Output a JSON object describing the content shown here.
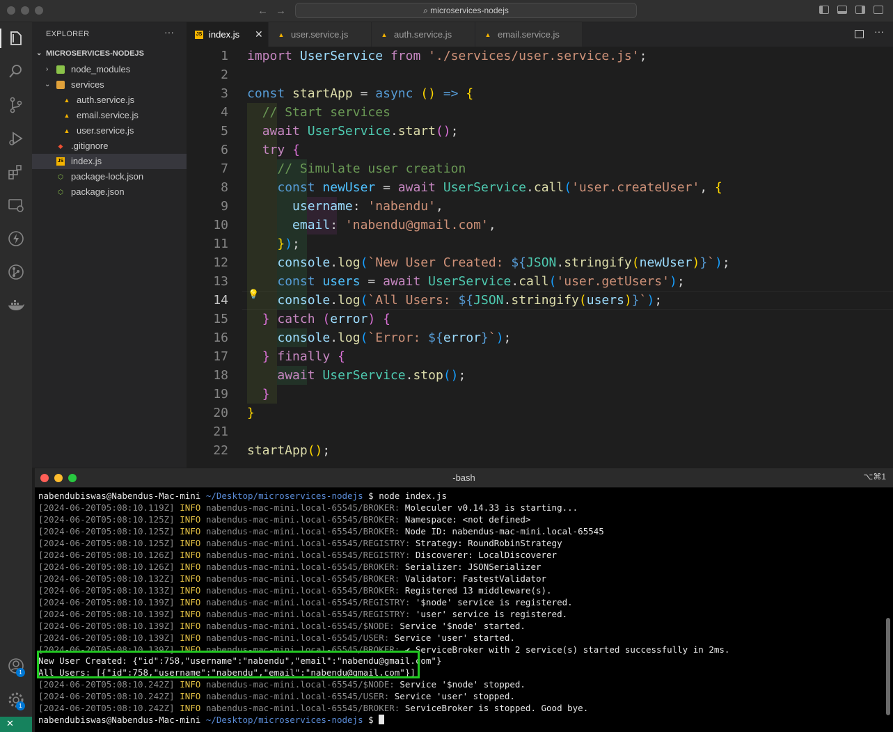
{
  "window": {
    "search": "microservices-nodejs"
  },
  "explorer": {
    "title": "EXPLORER",
    "more": "···",
    "project": "MICROSERVICES-NODEJS",
    "items": [
      "node_modules",
      "services",
      "auth.service.js",
      "email.service.js",
      "user.service.js",
      ".gitignore",
      "index.js",
      "package-lock.json",
      "package.json"
    ]
  },
  "activity": {
    "account_badge": "1",
    "settings_badge": "1"
  },
  "tabs": [
    {
      "label": "index.js",
      "close": "✕"
    },
    {
      "label": "user.service.js"
    },
    {
      "label": "auth.service.js"
    },
    {
      "label": "email.service.js"
    }
  ],
  "editor": {
    "line_numbers": [
      "1",
      "2",
      "3",
      "4",
      "5",
      "6",
      "7",
      "8",
      "9",
      "10",
      "11",
      "12",
      "13",
      "14",
      "15",
      "16",
      "17",
      "18",
      "19",
      "20",
      "21",
      "22"
    ],
    "current_line": "14"
  },
  "terminal": {
    "title": "-bash",
    "shortcut": "⌥⌘1",
    "prompt_user": "nabendubiswas@Nabendus-Mac-mini",
    "prompt_path": "~/Desktop/microservices-nodejs",
    "prompt_cmd": "$ node index.js",
    "prompt_end": "$",
    "logs": [
      {
        "ts": "[2024-06-20T05:08:10.119Z]",
        "lvl": "INFO",
        "src": "nabendus-mac-mini.local-65545/BROKER:",
        "msg": "Moleculer v0.14.33 is starting..."
      },
      {
        "ts": "[2024-06-20T05:08:10.125Z]",
        "lvl": "INFO",
        "src": "nabendus-mac-mini.local-65545/BROKER:",
        "msg": "Namespace: <not defined>"
      },
      {
        "ts": "[2024-06-20T05:08:10.125Z]",
        "lvl": "INFO",
        "src": "nabendus-mac-mini.local-65545/BROKER:",
        "msg": "Node ID: nabendus-mac-mini.local-65545"
      },
      {
        "ts": "[2024-06-20T05:08:10.125Z]",
        "lvl": "INFO",
        "src": "nabendus-mac-mini.local-65545/REGISTRY:",
        "msg": "Strategy: RoundRobinStrategy"
      },
      {
        "ts": "[2024-06-20T05:08:10.126Z]",
        "lvl": "INFO",
        "src": "nabendus-mac-mini.local-65545/REGISTRY:",
        "msg": "Discoverer: LocalDiscoverer"
      },
      {
        "ts": "[2024-06-20T05:08:10.126Z]",
        "lvl": "INFO",
        "src": "nabendus-mac-mini.local-65545/BROKER:",
        "msg": "Serializer: JSONSerializer"
      },
      {
        "ts": "[2024-06-20T05:08:10.132Z]",
        "lvl": "INFO",
        "src": "nabendus-mac-mini.local-65545/BROKER:",
        "msg": "Validator: FastestValidator"
      },
      {
        "ts": "[2024-06-20T05:08:10.133Z]",
        "lvl": "INFO",
        "src": "nabendus-mac-mini.local-65545/BROKER:",
        "msg": "Registered 13 middleware(s)."
      },
      {
        "ts": "[2024-06-20T05:08:10.139Z]",
        "lvl": "INFO",
        "src": "nabendus-mac-mini.local-65545/REGISTRY:",
        "msg": "'$node' service is registered."
      },
      {
        "ts": "[2024-06-20T05:08:10.139Z]",
        "lvl": "INFO",
        "src": "nabendus-mac-mini.local-65545/REGISTRY:",
        "msg": "'user' service is registered."
      },
      {
        "ts": "[2024-06-20T05:08:10.139Z]",
        "lvl": "INFO",
        "src": "nabendus-mac-mini.local-65545/$NODE:",
        "msg": "Service '$node' started."
      },
      {
        "ts": "[2024-06-20T05:08:10.139Z]",
        "lvl": "INFO",
        "src": "nabendus-mac-mini.local-65545/USER:",
        "msg": "Service 'user' started."
      },
      {
        "ts": "[2024-06-20T05:08:10.139Z]",
        "lvl": "INFO",
        "src": "nabendus-mac-mini.local-65545/BROKER:",
        "msg": "✔ ServiceBroker with 2 service(s) started successfully in 2ms."
      }
    ],
    "output": [
      "New User Created: {\"id\":758,\"username\":\"nabendu\",\"email\":\"nabendu@gmail.com\"}",
      "All Users: [{\"id\":758,\"username\":\"nabendu\",\"email\":\"nabendu@gmail.com\"}]"
    ],
    "logs2": [
      {
        "ts": "[2024-06-20T05:08:10.242Z]",
        "lvl": "INFO",
        "src": "nabendus-mac-mini.local-65545/$NODE:",
        "msg": "Service '$node' stopped."
      },
      {
        "ts": "[2024-06-20T05:08:10.242Z]",
        "lvl": "INFO",
        "src": "nabendus-mac-mini.local-65545/USER:",
        "msg": "Service 'user' stopped."
      },
      {
        "ts": "[2024-06-20T05:08:10.242Z]",
        "lvl": "INFO",
        "src": "nabendus-mac-mini.local-65545/BROKER:",
        "msg": "ServiceBroker is stopped. Good bye."
      }
    ]
  }
}
